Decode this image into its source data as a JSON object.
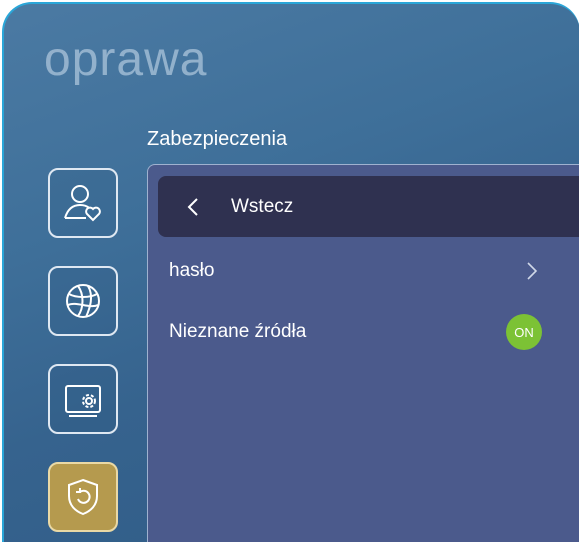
{
  "header": {
    "title": "oprawa"
  },
  "section": {
    "title": "Zabezpieczenia"
  },
  "sidebar": {
    "items": [
      {
        "icon": "user-heart-icon"
      },
      {
        "icon": "network-globe-icon"
      },
      {
        "icon": "display-settings-icon"
      },
      {
        "icon": "security-shield-icon",
        "active": true
      }
    ]
  },
  "panel": {
    "back_label": "Wstecz",
    "rows": [
      {
        "label": "hasło"
      },
      {
        "label": "Nieznane źródła",
        "toggle": "ON"
      }
    ]
  },
  "colors": {
    "accent_active": "#b59a4e",
    "toggle_on": "#7cc235",
    "panel_bg": "#4b5a8c",
    "back_bar_bg": "#2f3150"
  }
}
